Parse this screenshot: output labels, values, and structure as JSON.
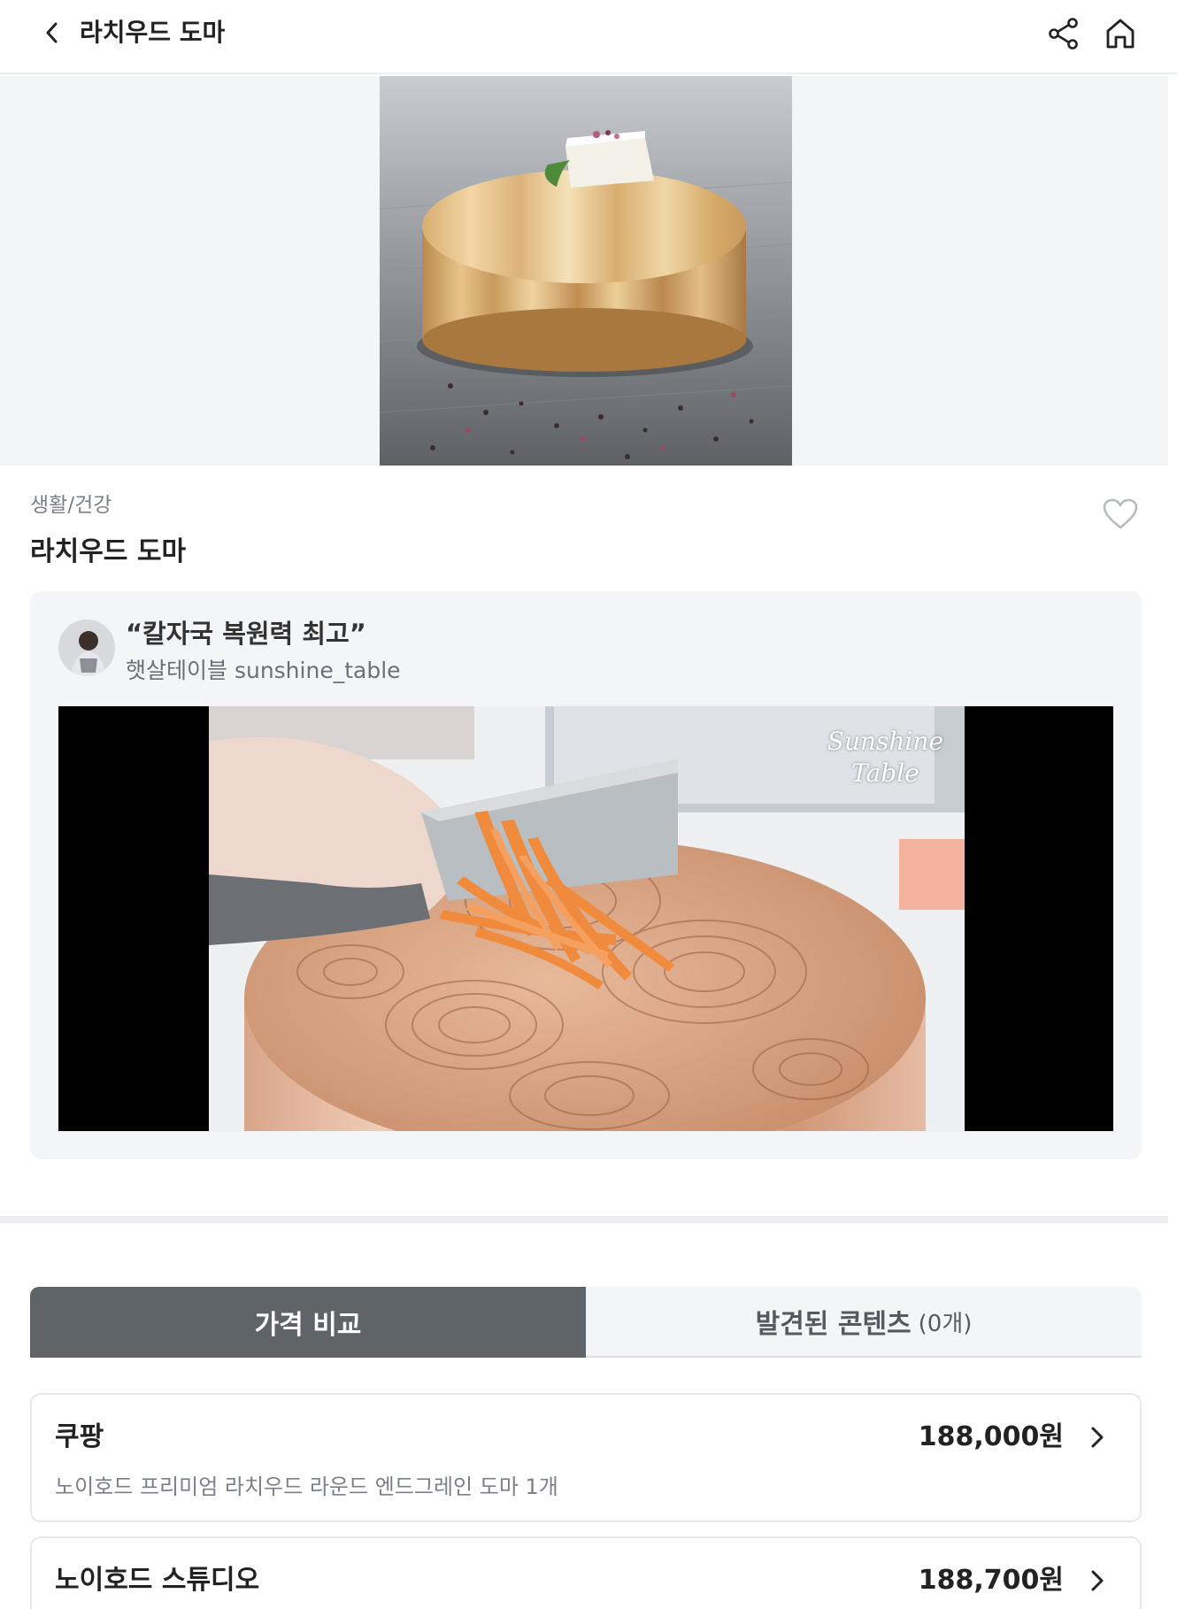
{
  "header": {
    "title": "라치우드 도마",
    "back_icon": "chevron-left-icon",
    "share_icon": "share-icon",
    "home_icon": "home-icon"
  },
  "product": {
    "category": "생활/건강",
    "name": "라치우드 도마",
    "favorite_icon": "heart-outline-icon"
  },
  "review": {
    "quote": "“칼자국 복원력 최고”",
    "author": "햇살테이블 sunshine_table",
    "video_watermark_line1": "Sunshine",
    "video_watermark_line2": "Table"
  },
  "tabs": [
    {
      "label": "가격 비교",
      "count": "",
      "active": true
    },
    {
      "label": "발견된 콘텐츠",
      "count": "(0개)",
      "active": false
    }
  ],
  "offers": [
    {
      "store": "쿠팡",
      "price": "188,000원",
      "description": "노이호드 프리미엄 라치우드 라운드 엔드그레인 도마 1개"
    },
    {
      "store": "노이호드 스튜디오",
      "price": "188,700원",
      "description": ""
    }
  ],
  "colors": {
    "active_tab": "#5f6469",
    "card_bg": "#f4f5f7",
    "muted_text": "#7b8088"
  }
}
